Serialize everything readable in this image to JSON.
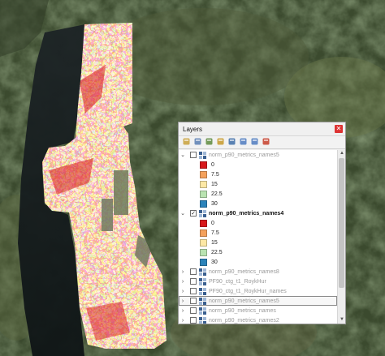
{
  "panel": {
    "title": "Layers",
    "close_glyph": "✕"
  },
  "toolbar": [
    {
      "name": "open-layer-styling-icon",
      "color": "#c9a13b"
    },
    {
      "name": "add-group-icon",
      "color": "#5a7fb3"
    },
    {
      "name": "manage-map-themes-icon",
      "color": "#5e8b3e"
    },
    {
      "name": "filter-legend-icon",
      "color": "#c79a2a"
    },
    {
      "name": "filter-by-expression-icon",
      "color": "#3f6fa8"
    },
    {
      "name": "expand-all-icon",
      "color": "#4f7bbf"
    },
    {
      "name": "collapse-all-icon",
      "color": "#4f7bbf"
    },
    {
      "name": "remove-layer-icon",
      "color": "#c7402c"
    }
  ],
  "legend_classes": [
    {
      "label": "0",
      "color": "#d7191c"
    },
    {
      "label": "7.5",
      "color": "#f4a15c"
    },
    {
      "label": "15",
      "color": "#fde8a5"
    },
    {
      "label": "22.5",
      "color": "#b9e3b1"
    },
    {
      "label": "30",
      "color": "#2b83ba"
    }
  ],
  "layers": [
    {
      "name": "norm_p90_metrics_names5",
      "expanded": true,
      "checked": false,
      "style": "dim",
      "show_legend": true
    },
    {
      "name": "norm_p90_metrics_names4",
      "expanded": true,
      "checked": true,
      "style": "bold",
      "show_legend": true
    },
    {
      "name": "norm_p90_metrics_names8",
      "expanded": false,
      "checked": false,
      "style": "dim",
      "show_legend": false
    },
    {
      "name": "PF90_ctg_t1_RoykHur",
      "expanded": false,
      "checked": false,
      "style": "dim",
      "show_legend": false
    },
    {
      "name": "PF90_ctg_t1_RoykHur_names",
      "expanded": false,
      "checked": false,
      "style": "dim",
      "show_legend": false
    },
    {
      "name": "norm_p90_metrics_names5",
      "expanded": false,
      "checked": false,
      "style": "dim",
      "show_legend": false,
      "selected": true
    },
    {
      "name": "norm_p90_metrics_names",
      "expanded": false,
      "checked": false,
      "style": "dim",
      "show_legend": false
    },
    {
      "name": "norm_p90_metrics_names2",
      "expanded": false,
      "checked": false,
      "style": "dim",
      "show_legend": false
    }
  ],
  "glyphs": {
    "expanded": "⌄",
    "collapsed": "›",
    "check": "✓",
    "scroll_up": "▲",
    "scroll_down": "▼"
  }
}
